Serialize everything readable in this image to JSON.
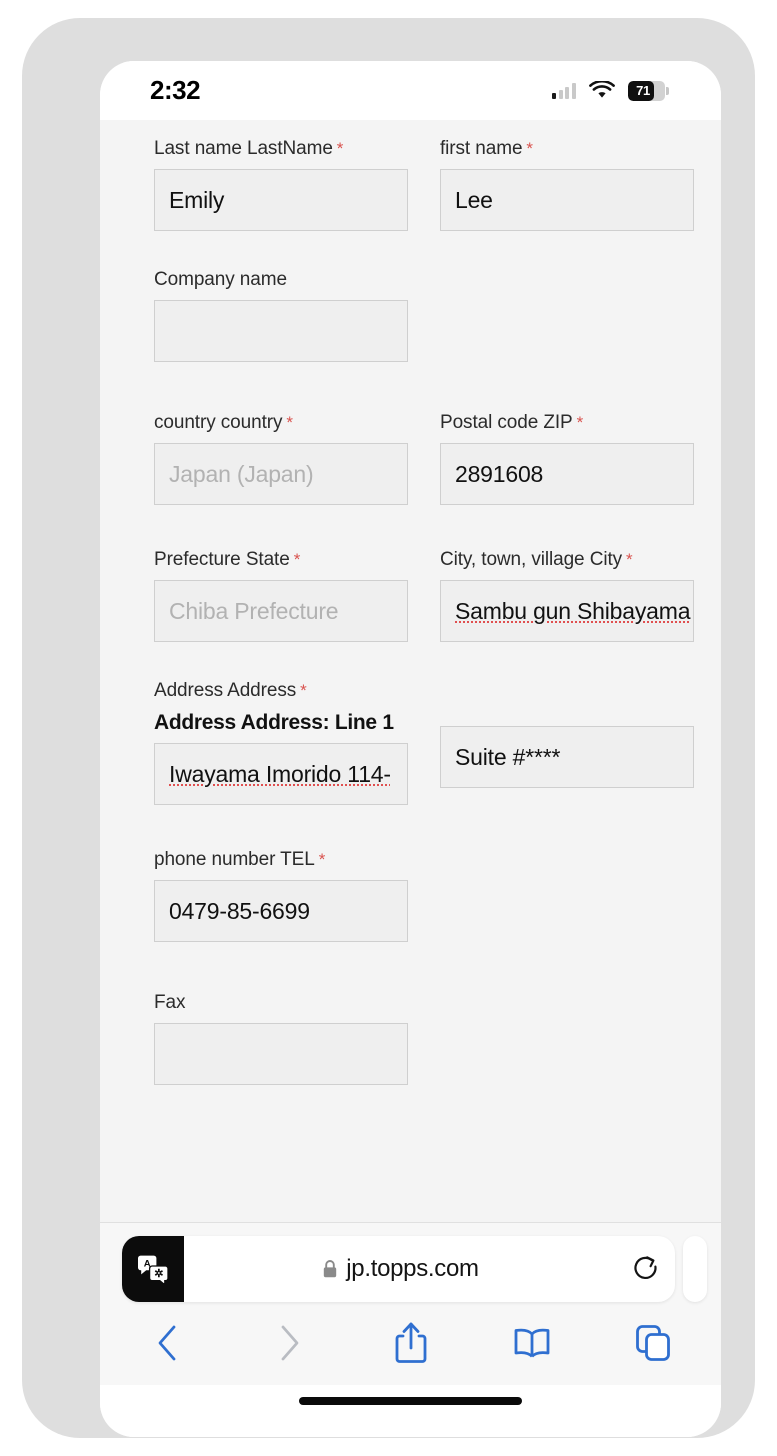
{
  "status_bar": {
    "time": "2:32",
    "cellular_icon": "signal-bars-icon",
    "wifi_icon": "wifi-icon",
    "battery_icon": "battery-icon",
    "battery_percent": "71"
  },
  "form": {
    "fields": [
      {
        "id": "last-name",
        "label": "Last name LastName",
        "required": true,
        "value": "Emily",
        "is_placeholder": false,
        "spellcheck_error": false
      },
      {
        "id": "first-name",
        "label": "first name",
        "required": true,
        "value": "Lee",
        "is_placeholder": false,
        "spellcheck_error": false
      },
      {
        "id": "company-name",
        "label": "Company name",
        "required": false,
        "value": "",
        "is_placeholder": false,
        "spellcheck_error": false
      },
      {
        "id": "country",
        "label": "country country",
        "required": true,
        "value": "Japan (Japan)",
        "is_placeholder": true,
        "spellcheck_error": false
      },
      {
        "id": "postal-code",
        "label": "Postal code ZIP",
        "required": true,
        "value": "2891608",
        "is_placeholder": false,
        "spellcheck_error": false
      },
      {
        "id": "prefecture",
        "label": "Prefecture State",
        "required": true,
        "value": "Chiba Prefecture",
        "is_placeholder": true,
        "spellcheck_error": false
      },
      {
        "id": "city",
        "label": "City, town, village City",
        "required": true,
        "value": "Sambu gun Shibayama",
        "is_placeholder": false,
        "spellcheck_error": true
      },
      {
        "id": "address",
        "label": "Address Address",
        "required": true,
        "sublabel": "Address Address: Line 1",
        "value": "Iwayama Imorido 114-",
        "is_placeholder": false,
        "spellcheck_error": true
      },
      {
        "id": "address-line-2",
        "label": "",
        "required": false,
        "value": "Suite #****",
        "is_placeholder": false,
        "spellcheck_error": false
      },
      {
        "id": "phone",
        "label": "phone number TEL",
        "required": true,
        "value": "0479-85-6699",
        "is_placeholder": false,
        "spellcheck_error": false
      },
      {
        "id": "fax",
        "label": "Fax",
        "required": false,
        "value": "",
        "is_placeholder": false,
        "spellcheck_error": false
      }
    ],
    "required_marker": "*"
  },
  "browser": {
    "translate_icon": "translate-icon",
    "lock_icon": "lock-icon",
    "url": "jp.topps.com",
    "reload_icon": "reload-icon",
    "toolbar": [
      {
        "id": "back",
        "icon": "chevron-left-icon",
        "enabled": true
      },
      {
        "id": "forward",
        "icon": "chevron-right-icon",
        "enabled": false
      },
      {
        "id": "share",
        "icon": "share-icon",
        "enabled": true
      },
      {
        "id": "bookmarks",
        "icon": "book-icon",
        "enabled": true
      },
      {
        "id": "tabs",
        "icon": "tabs-icon",
        "enabled": true
      }
    ]
  },
  "colors": {
    "page_background": "#f4f4f4",
    "input_background": "#efefef",
    "input_border": "#cfcfcf",
    "required_asterisk": "#d9534f",
    "safari_accent": "#2f6fd0",
    "safari_disabled": "#b9bcc2",
    "device_frame": "#dedede",
    "spellcheck_underline": "#e05050"
  }
}
